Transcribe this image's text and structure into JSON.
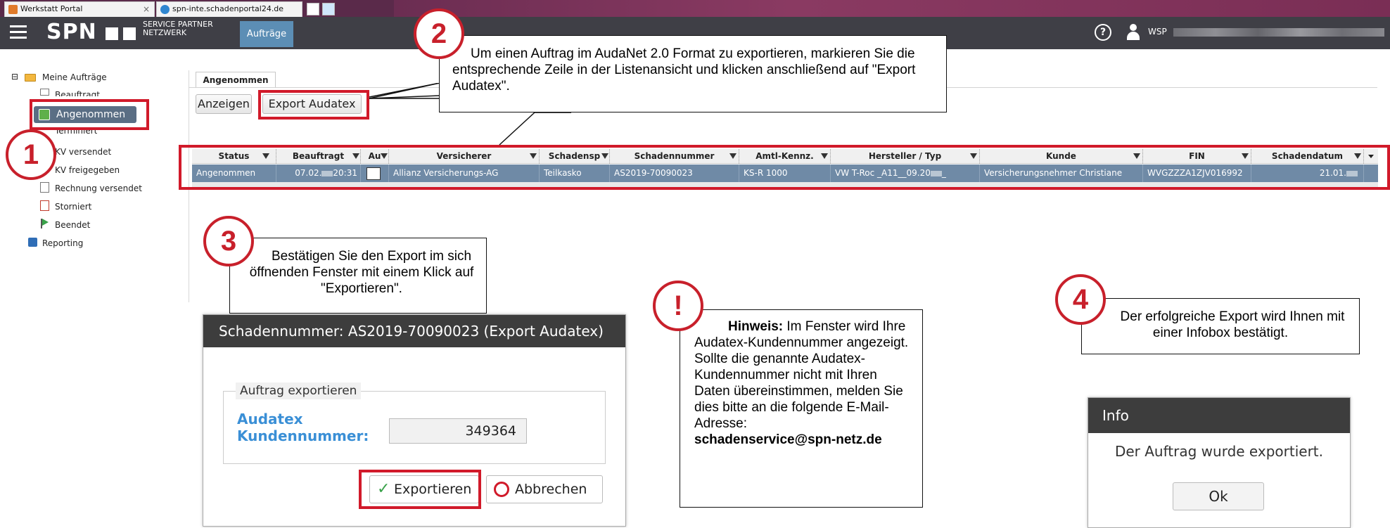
{
  "browser": {
    "tabs": [
      {
        "title": "Werkstatt Portal",
        "close": "×"
      },
      {
        "title": "spn-inte.schadenportal24.de"
      }
    ]
  },
  "header": {
    "logo": "SPN",
    "tagline": "SERVICE PARTNER NETZWERK",
    "nav_tab": "Aufträge",
    "help": "?",
    "user": "WSP"
  },
  "tree": {
    "root": "Meine Aufträge",
    "items": [
      "Beauftragt",
      "Angenommen",
      "Terminiert",
      "KV versendet",
      "KV freigegeben",
      "Rechnung versendet",
      "Storniert",
      "Beendet"
    ],
    "reporting": "Reporting"
  },
  "content": {
    "tab": "Angenommen",
    "btn_show": "Anzeigen",
    "btn_export": "Export Audatex"
  },
  "grid": {
    "columns": [
      "Status",
      "Beauftragt",
      "Au",
      "Versicherer",
      "Schadensp",
      "Schadennummer",
      "Amtl-Kennz.",
      "Hersteller / Typ",
      "Kunde",
      "FIN",
      "Schadendatum"
    ],
    "row": {
      "status": "Angenommen",
      "beauftragt_a": "07.02.",
      "beauftragt_b": "20:31",
      "versicherer": "Allianz Versicherungs-AG",
      "schadensp": "Teilkasko",
      "schadennummer": "AS2019-70090023",
      "kennz": "KS-R 1000",
      "hersteller": "VW T-Roc _A11__09.20",
      "hersteller_end": "_",
      "kunde": "Versicherungsnehmer Christiane",
      "fin": "WVGZZZA1ZJV016992",
      "datum": "21.01."
    }
  },
  "callouts": {
    "c1": "1",
    "c2": "2",
    "c2_text": "Um einen Auftrag im AudaNet 2.0 Format zu exportieren, markieren Sie die entsprechende Zeile in der Listenansicht und klicken anschließend auf \"Export Audatex\".",
    "c3": "3",
    "c3_text": "Bestätigen Sie den Export im sich öffnenden Fenster mit einem Klick auf \"Exportieren\".",
    "warn": "!",
    "warn_title": "Hinweis:",
    "warn_text": "Im Fenster wird Ihre Audatex-Kundennummer angezeigt. Sollte die genannte Audatex-Kundennummer nicht mit Ihren Daten übereinstimmen, melden Sie dies bitte an die folgende E-Mail-Adresse:",
    "warn_email": "schadenservice@spn-netz.de",
    "c4": "4",
    "c4_text": "Der erfolgreiche Export wird Ihnen mit einer Infobox bestätigt."
  },
  "export_dialog": {
    "title": "Schadennummer: AS2019-70090023 (Export Audatex)",
    "legend": "Auftrag exportieren",
    "label_1": "Audatex",
    "label_2": "Kundennummer:",
    "value": "349364",
    "btn_export": "Exportieren",
    "btn_cancel": "Abbrechen"
  },
  "info_dialog": {
    "title": "Info",
    "message": "Der Auftrag wurde exportiert.",
    "btn": "Ok"
  },
  "colors": {
    "highlight": "#d11a2a",
    "selection": "#6f8aa6",
    "accent": "#3a8fd6"
  }
}
